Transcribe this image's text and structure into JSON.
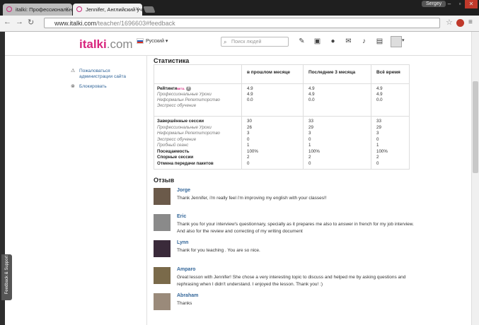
{
  "browser": {
    "tabs": [
      {
        "title": "italki: Профессиональн"
      },
      {
        "title": "Jennifer, Английский учи"
      }
    ],
    "user": "Sergey",
    "url_host": "www.italki.com",
    "url_path": "/teacher/1696603#feedback"
  },
  "site": {
    "logo_main": "italki",
    "logo_suffix": ".com",
    "language": "Русский",
    "search_placeholder": "Поиск людей"
  },
  "sidebar": {
    "report": "Пожаловаться администрации сайта",
    "block": "Блокировать"
  },
  "stats": {
    "title": "Статистика",
    "columns": [
      "в прошлом месяце",
      "Последние 3 месяца",
      "Всё время"
    ],
    "ratings_label": "Рейтинги",
    "ratings_badge": "BETA",
    "ratings_rows": [
      {
        "label": "Профессиональные Уроки",
        "values": [
          "4.9",
          "4.9",
          "4.9"
        ]
      },
      {
        "label": "Неформальн Репетиторство",
        "values": [
          "4.9",
          "4.9",
          "4.9"
        ]
      },
      {
        "label": "Экспресс обучение",
        "values": [
          "0.0",
          "0.0",
          "0.0"
        ]
      }
    ],
    "sessions_rows": [
      {
        "label": "Завершённые сессии",
        "bold": true,
        "values": [
          "30",
          "33",
          "33"
        ]
      },
      {
        "label": "Профессиональные Уроки",
        "bold": false,
        "values": [
          "26",
          "29",
          "29"
        ]
      },
      {
        "label": "Неформальн Репетиторство",
        "bold": false,
        "values": [
          "3",
          "3",
          "3"
        ]
      },
      {
        "label": "Экспресс обучение",
        "bold": false,
        "values": [
          "0",
          "0",
          "0"
        ]
      },
      {
        "label": "Пробный сеанс",
        "bold": false,
        "values": [
          "1",
          "1",
          "1"
        ]
      },
      {
        "label": "Посещаемость",
        "bold": true,
        "values": [
          "100%",
          "100%",
          "100%"
        ]
      },
      {
        "label": "Спорные сессии",
        "bold": true,
        "values": [
          "2",
          "2",
          "2"
        ]
      },
      {
        "label": "Отмена передачи пакетов",
        "bold": true,
        "values": [
          "0",
          "0",
          "0"
        ]
      }
    ]
  },
  "reviews": {
    "title": "Отзыв",
    "items": [
      {
        "name": "Jorge",
        "text": "Thank Jennifer, i'm really feel i'm improving my english with your classes!!",
        "avatar_color": "#6b5a4a"
      },
      {
        "name": "Eric",
        "text": "Thank you for your interview's questionnary, specially as it prepares me also to answer in french for my job interview. And also for the review and correcting of my writing document",
        "avatar_color": "#8a8a8a"
      },
      {
        "name": "Lynn",
        "text": "Thank for you teaching . You are so nice.",
        "avatar_color": "#3a2a3a"
      },
      {
        "name": "Amparo",
        "text": "Great lesson with Jennifer! She chose a very interesting topic to discuss and helped me by asking questions and rephrasing when I didn't understand. I enjoyed the lesson. Thank you! :)",
        "avatar_color": "#7a6a4a"
      },
      {
        "name": "Abraham",
        "text": "Thanks",
        "avatar_color": "#9a8a7a"
      }
    ]
  },
  "feedback_tab": "Feedback & Support",
  "colors": {
    "brand": "#d8257d",
    "link": "#336699"
  }
}
